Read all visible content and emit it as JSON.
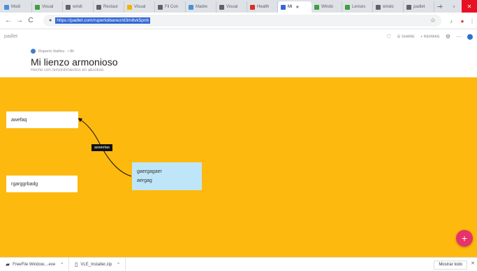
{
  "browser": {
    "tabs": [
      {
        "label": "Modi",
        "color": "#4a90d9"
      },
      {
        "label": "Visual",
        "color": "#3c9f40"
      },
      {
        "label": "windi",
        "color": "#5f6368"
      },
      {
        "label": "Restaur",
        "color": "#5f6368"
      },
      {
        "label": "Visual",
        "color": "#f0b400"
      },
      {
        "label": "Fil Con",
        "color": "#5f6368"
      },
      {
        "label": "Madre",
        "color": "#4a90d9"
      },
      {
        "label": "Visual",
        "color": "#5f6368"
      },
      {
        "label": "Health",
        "color": "#d93025"
      },
      {
        "label": "Mi",
        "color": "#3367d6",
        "active": true
      },
      {
        "label": "Windo",
        "color": "#3c9f40"
      },
      {
        "label": "Lenses",
        "color": "#3c9f40"
      },
      {
        "label": "windo",
        "color": "#5f6368"
      },
      {
        "label": "padlet",
        "color": "#5f6368"
      }
    ],
    "new_tab": "+",
    "window_controls": {
      "minimize": "–",
      "maximize": "▫",
      "close": "✕"
    },
    "nav": {
      "back": "←",
      "forward": "→",
      "reload": "C"
    },
    "url": "https://padlet.com/rupertoibanez/d3m8vk5pnb",
    "star_icon": "☆",
    "extension_icons": [
      "☆",
      "♪",
      "●",
      "⋮"
    ]
  },
  "padlet": {
    "brand": "padlet",
    "header_actions": {
      "heart": "♡",
      "share": "☰ SHARE",
      "remake": "+ REMAKE",
      "settings": "⚙",
      "more": "···"
    },
    "breadcrumb": {
      "author": "Ruperto Ibáñez",
      "time": "• 8h"
    },
    "title": "Mi lienzo armonioso",
    "subtitle": "Hecho con remordimientos en absoluto",
    "posts": [
      {
        "id": "p1",
        "text": "awefaq"
      },
      {
        "id": "p2",
        "text": "rgarggrbadg"
      },
      {
        "id": "p3",
        "title": "gaergagaer",
        "body": "aergag"
      }
    ],
    "connection_label": "aswertas",
    "fab": "+",
    "canvas_color": "#fdb90d"
  },
  "downloads": {
    "items": [
      {
        "name": "FreeFile Window....exe",
        "icon": "file-exe"
      },
      {
        "name": "VLE_Installer.zip",
        "icon": "file-zip"
      }
    ],
    "show_all": "Mostrar todo",
    "close": "✕"
  }
}
